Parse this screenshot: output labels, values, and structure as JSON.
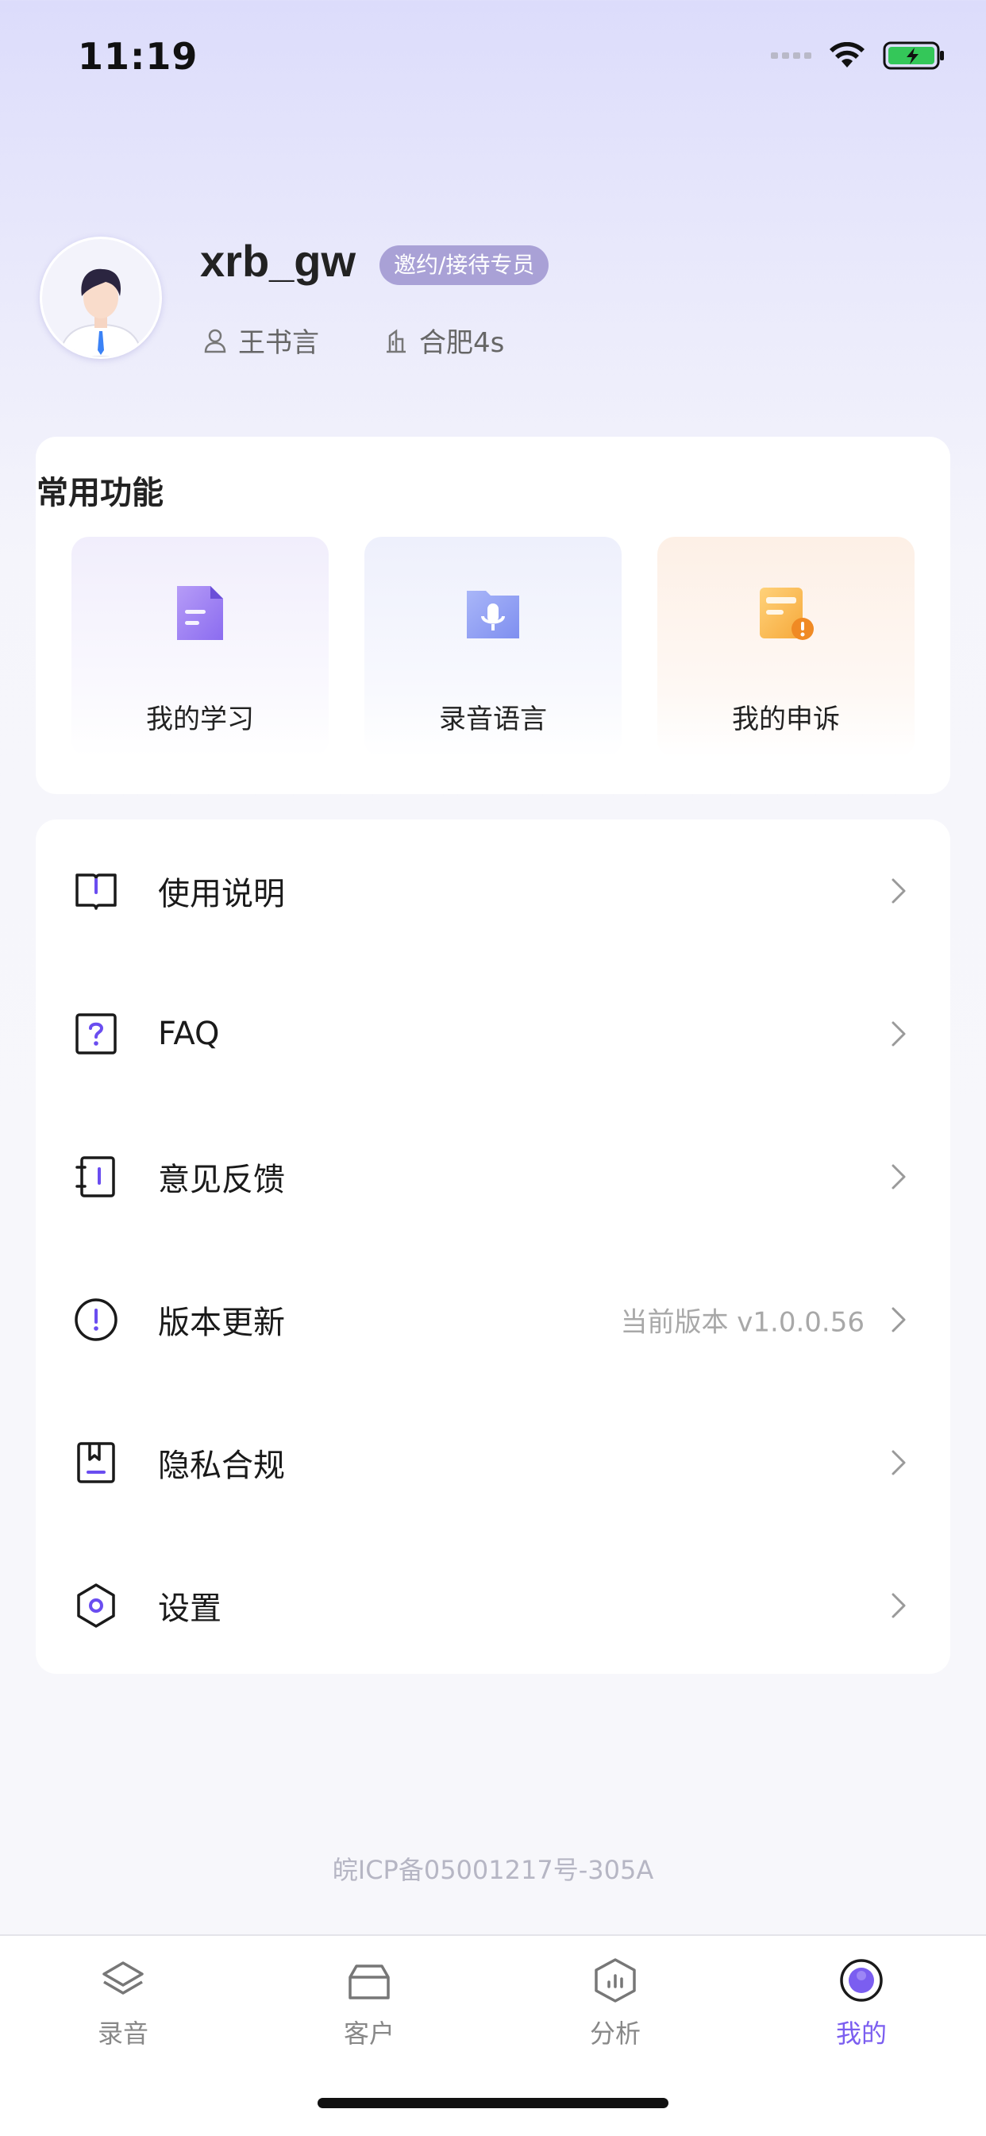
{
  "status_bar": {
    "time": "11:19"
  },
  "profile": {
    "username": "xrb_gw",
    "role": "邀约/接待专员",
    "name": "王书言",
    "store": "合肥4s"
  },
  "favorites": {
    "title": "常用功能",
    "items": [
      {
        "label": "我的学习",
        "icon": "document-icon"
      },
      {
        "label": "录音语言",
        "icon": "mic-folder-icon"
      },
      {
        "label": "我的申诉",
        "icon": "complaint-icon"
      }
    ]
  },
  "menu": {
    "items": [
      {
        "label": "使用说明",
        "icon": "book-icon"
      },
      {
        "label": "FAQ",
        "icon": "question-icon"
      },
      {
        "label": "意见反馈",
        "icon": "notebook-icon"
      },
      {
        "label": "版本更新",
        "icon": "alert-circle-icon",
        "value": "当前版本 v1.0.0.56"
      },
      {
        "label": "隐私合规",
        "icon": "bookmark-icon"
      },
      {
        "label": "设置",
        "icon": "hexagon-gear-icon"
      }
    ]
  },
  "footer": {
    "icp": "皖ICP备05001217号-305A"
  },
  "tabbar": {
    "tabs": [
      {
        "label": "录音",
        "icon": "layers-icon",
        "active": false
      },
      {
        "label": "客户",
        "icon": "box-icon",
        "active": false
      },
      {
        "label": "分析",
        "icon": "chart-hexagon-icon",
        "active": false
      },
      {
        "label": "我的",
        "icon": "profile-icon",
        "active": true
      }
    ],
    "active_color": "#7b5ef0"
  },
  "colors": {
    "accent": "#7b5ef0",
    "badge": "#a9a1d6"
  }
}
